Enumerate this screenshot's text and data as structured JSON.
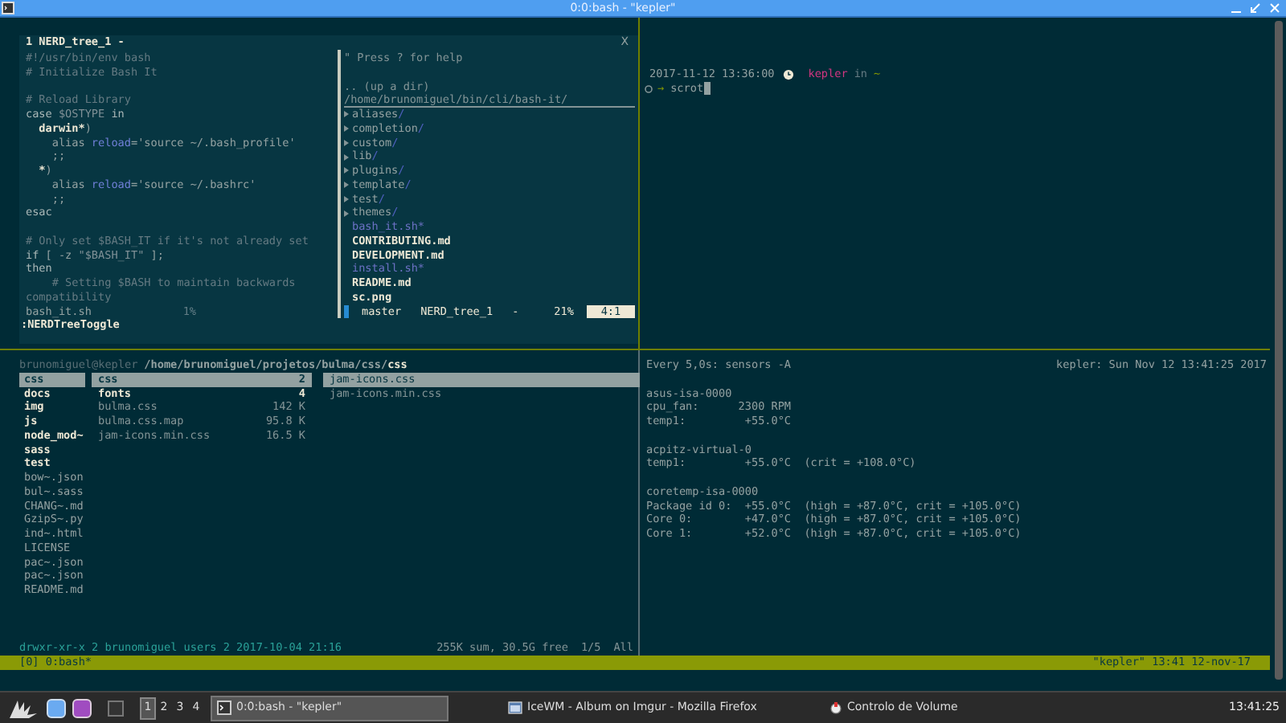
{
  "window": {
    "title": "0:0:bash - \"kepler\""
  },
  "vim": {
    "tabline": {
      "label": "1 NERD_tree_1 -",
      "close": "X"
    },
    "code_lines": [
      {
        "kind": "code",
        "segments": [
          {
            "text": "#!/usr/bin/env bash",
            "kind": "comment"
          }
        ]
      },
      {
        "kind": "code",
        "segments": [
          {
            "text": "# Initialize Bash It",
            "kind": "comment"
          }
        ]
      },
      {
        "kind": "blank"
      },
      {
        "kind": "code",
        "segments": [
          {
            "text": "# Reload Library",
            "kind": "comment"
          }
        ]
      },
      {
        "kind": "code",
        "segments": [
          {
            "text": "case",
            "kind": "keyword"
          },
          {
            "text": " $OSTYPE",
            "kind": "variable"
          },
          {
            "text": " in",
            "kind": "keyword"
          }
        ]
      },
      {
        "kind": "code",
        "segments": [
          {
            "text": "  darwin*",
            "kind": "bold"
          },
          {
            "text": ")",
            "kind": "plain"
          }
        ]
      },
      {
        "kind": "code",
        "segments": [
          {
            "text": "    alias ",
            "kind": "plain"
          },
          {
            "text": "reload",
            "kind": "function"
          },
          {
            "text": "='source ~/.bash_profile'",
            "kind": "plain"
          }
        ]
      },
      {
        "kind": "code",
        "segments": [
          {
            "text": "    ;;",
            "kind": "plain"
          }
        ]
      },
      {
        "kind": "code",
        "segments": [
          {
            "text": "  *",
            "kind": "bold"
          },
          {
            "text": ")",
            "kind": "plain"
          }
        ]
      },
      {
        "kind": "code",
        "segments": [
          {
            "text": "    alias ",
            "kind": "plain"
          },
          {
            "text": "reload",
            "kind": "function"
          },
          {
            "text": "='source ~/.bashrc'",
            "kind": "plain"
          }
        ]
      },
      {
        "kind": "code",
        "segments": [
          {
            "text": "    ;;",
            "kind": "plain"
          }
        ]
      },
      {
        "kind": "code",
        "segments": [
          {
            "text": "esac",
            "kind": "keyword"
          }
        ]
      },
      {
        "kind": "blank"
      },
      {
        "kind": "code",
        "segments": [
          {
            "text": "# Only set $BASH_IT if it's not already set",
            "kind": "comment"
          }
        ]
      },
      {
        "kind": "code",
        "segments": [
          {
            "text": "if",
            "kind": "keyword"
          },
          {
            "text": " [ -z ",
            "kind": "plain"
          },
          {
            "text": "\"$BASH_IT\"",
            "kind": "variable"
          },
          {
            "text": " ];",
            "kind": "plain"
          }
        ]
      },
      {
        "kind": "code",
        "segments": [
          {
            "text": "then",
            "kind": "keyword"
          }
        ]
      },
      {
        "kind": "code",
        "segments": [
          {
            "text": "    # Setting $BASH to maintain backwards",
            "kind": "comment"
          }
        ]
      },
      {
        "kind": "code",
        "segments": [
          {
            "text": "compatibility",
            "kind": "comment"
          }
        ]
      }
    ],
    "file_status": {
      "name": "bash_it.sh",
      "percent": "1%"
    },
    "nerdtree": {
      "help": "\" Press ? for help",
      "up": ".. (up a dir)",
      "path": "/home/brunomiguel/bin/cli/bash-it/",
      "entries": [
        {
          "name": "aliases",
          "suffix": "/",
          "kind": "dir"
        },
        {
          "name": "completion",
          "suffix": "/",
          "kind": "dir"
        },
        {
          "name": "custom",
          "suffix": "/",
          "kind": "dir"
        },
        {
          "name": "lib",
          "suffix": "/",
          "kind": "dir"
        },
        {
          "name": "plugins",
          "suffix": "/",
          "kind": "dir"
        },
        {
          "name": "template",
          "suffix": "/",
          "kind": "dir"
        },
        {
          "name": "test",
          "suffix": "/",
          "kind": "dir"
        },
        {
          "name": "themes",
          "suffix": "/",
          "kind": "dir"
        },
        {
          "name": "bash_it.sh",
          "suffix": "*",
          "kind": "exec"
        },
        {
          "name": "CONTRIBUTING.md",
          "kind": "file"
        },
        {
          "name": "DEVELOPMENT.md",
          "kind": "file"
        },
        {
          "name": "install.sh",
          "suffix": "*",
          "kind": "exec"
        },
        {
          "name": "README.md",
          "kind": "file"
        },
        {
          "name": "sc.png",
          "kind": "file"
        }
      ]
    },
    "status_line": {
      "branch": "master",
      "buffer": "NERD_tree_1",
      "modified": "-",
      "percent": "21%",
      "position": "4:1"
    },
    "command_line": ":NERDTreeToggle"
  },
  "prompt": {
    "timestamp": "2017-11-12 13:36:00",
    "host": "kepler",
    "in": "in",
    "dir": "~",
    "arrow": "→",
    "command": "scrot"
  },
  "ranger": {
    "user_host": "brunomiguel@kepler",
    "path": "/home/brunomiguel/projetos/bulma/css/",
    "current": "css",
    "parent": [
      {
        "name": "css",
        "kind": "dir",
        "selected": true
      },
      {
        "name": "docs",
        "kind": "dir",
        "selected": false
      },
      {
        "name": "img",
        "kind": "dir",
        "selected": false
      },
      {
        "name": "js",
        "kind": "dir",
        "selected": false
      },
      {
        "name": "node_mod~",
        "kind": "dir",
        "selected": false
      },
      {
        "name": "sass",
        "kind": "dir",
        "selected": false
      },
      {
        "name": "test",
        "kind": "dir",
        "selected": false
      },
      {
        "name": "bow~.json",
        "kind": "file",
        "selected": false
      },
      {
        "name": "bul~.sass",
        "kind": "file",
        "selected": false
      },
      {
        "name": "CHANG~.md",
        "kind": "file",
        "selected": false
      },
      {
        "name": "GzipS~.py",
        "kind": "file",
        "selected": false
      },
      {
        "name": "ind~.html",
        "kind": "file",
        "selected": false
      },
      {
        "name": "LICENSE",
        "kind": "file",
        "selected": false
      },
      {
        "name": "pac~.json",
        "kind": "file",
        "selected": false
      },
      {
        "name": "pac~.json",
        "kind": "file",
        "selected": false
      },
      {
        "name": "README.md",
        "kind": "file",
        "selected": false
      }
    ],
    "files": [
      {
        "name": "css",
        "size": "2",
        "kind": "dir",
        "selected": true
      },
      {
        "name": "fonts",
        "size": "4",
        "kind": "dir",
        "selected": false
      },
      {
        "name": "bulma.css",
        "size": "142 K",
        "kind": "file",
        "selected": false
      },
      {
        "name": "bulma.css.map",
        "size": "95.8 K",
        "kind": "file",
        "selected": false
      },
      {
        "name": "jam-icons.min.css",
        "size": "16.5 K",
        "kind": "file",
        "selected": false
      }
    ],
    "preview": [
      {
        "name": "jam-icons.css",
        "selected": true
      },
      {
        "name": "jam-icons.min.css",
        "selected": false
      }
    ],
    "footer": {
      "perms": "drwxr-xr-x 2 brunomiguel users 2 2017-10-04 21:16",
      "info": "255K sum, 30.5G free",
      "position": "1/5",
      "range": "All"
    }
  },
  "sensors": {
    "command": "Every 5,0s: sensors -A",
    "host_time": "kepler: Sun Nov 12 13:41:25 2017",
    "groups": [
      [
        "asus-isa-0000",
        "cpu_fan:      2300 RPM",
        "temp1:         +55.0°C"
      ],
      [
        "acpitz-virtual-0",
        "temp1:         +55.0°C  (crit = +108.0°C)"
      ],
      [
        "coretemp-isa-0000",
        "Package id 0:  +55.0°C  (high = +87.0°C, crit = +105.0°C)",
        "Core 0:        +47.0°C  (high = +87.0°C, crit = +105.0°C)",
        "Core 1:        +52.0°C  (high = +87.0°C, crit = +105.0°C)"
      ]
    ]
  },
  "tmux_status": {
    "left": "[0] 0:bash*",
    "right": "\"kepler\" 13:41 12-nov-17"
  },
  "taskbar": {
    "workspaces": [
      {
        "label": "1",
        "selected": true
      },
      {
        "label": "2",
        "selected": false
      },
      {
        "label": "3",
        "selected": false
      },
      {
        "label": "4",
        "selected": false
      }
    ],
    "tasks": [
      {
        "label": "0:0:bash - \"kepler\"",
        "kind": "terminal",
        "selected": true
      },
      {
        "label": "IceWM - Album on Imgur - Mozilla Firefox",
        "kind": "browser",
        "selected": false
      },
      {
        "label": "Controlo de Volume",
        "kind": "volume",
        "selected": false
      }
    ],
    "clock": "13:41:25"
  }
}
